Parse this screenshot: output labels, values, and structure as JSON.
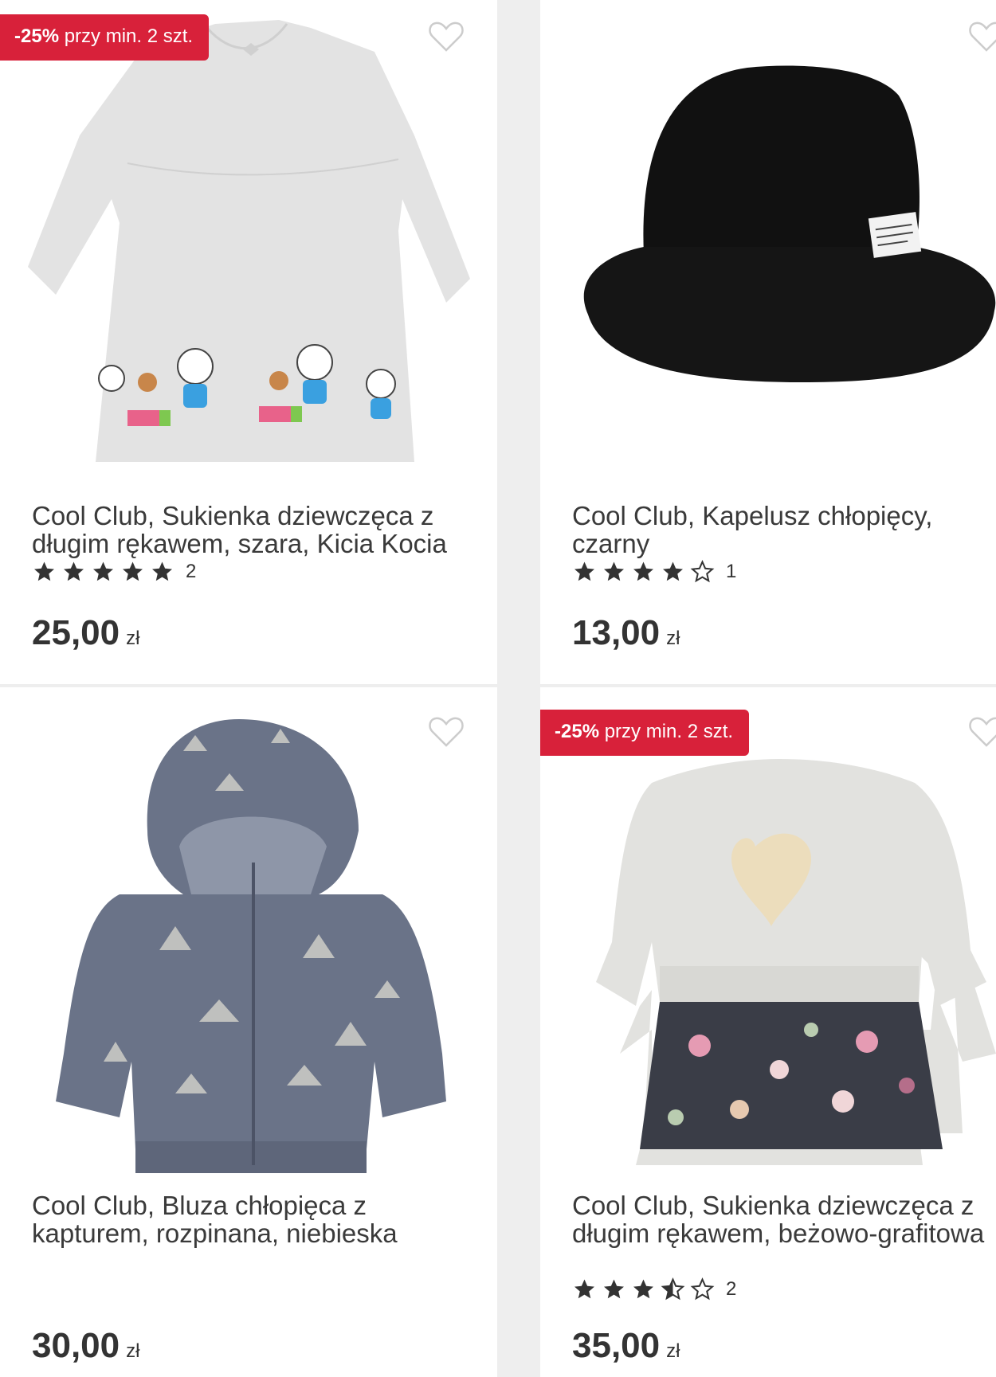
{
  "products": [
    {
      "badge_bold": "-25%",
      "badge_text": " przy min. 2 szt.",
      "title": "Cool Club, Sukienka dziewczęca z długim rękawem, szara, Kicia Kocia",
      "rating": 5,
      "rating_count": "2",
      "price": "25,00",
      "currency": "zł",
      "image_icon": "grey-dress-image"
    },
    {
      "badge_bold": "",
      "badge_text": "",
      "title": "Cool Club, Kapelusz chłopięcy, czarny",
      "rating": 4,
      "rating_count": "1",
      "price": "13,00",
      "currency": "zł",
      "image_icon": "black-bucket-hat-image"
    },
    {
      "badge_bold": "",
      "badge_text": "",
      "title": "Cool Club, Bluza chłopięca z kapturem, rozpinana, niebieska",
      "rating": null,
      "rating_count": "",
      "price": "30,00",
      "currency": "zł",
      "image_icon": "blue-hoodie-image"
    },
    {
      "badge_bold": "-25%",
      "badge_text": " przy min. 2 szt.",
      "title": "Cool Club, Sukienka dziewczęca z długim rękawem, beżowo-grafitowa",
      "rating": 3.5,
      "rating_count": "2",
      "price": "35,00",
      "currency": "zł",
      "image_icon": "beige-graphite-dress-image"
    }
  ],
  "colors": {
    "badge": "#d8213a",
    "star": "#333333",
    "background": "#eeeeee"
  }
}
